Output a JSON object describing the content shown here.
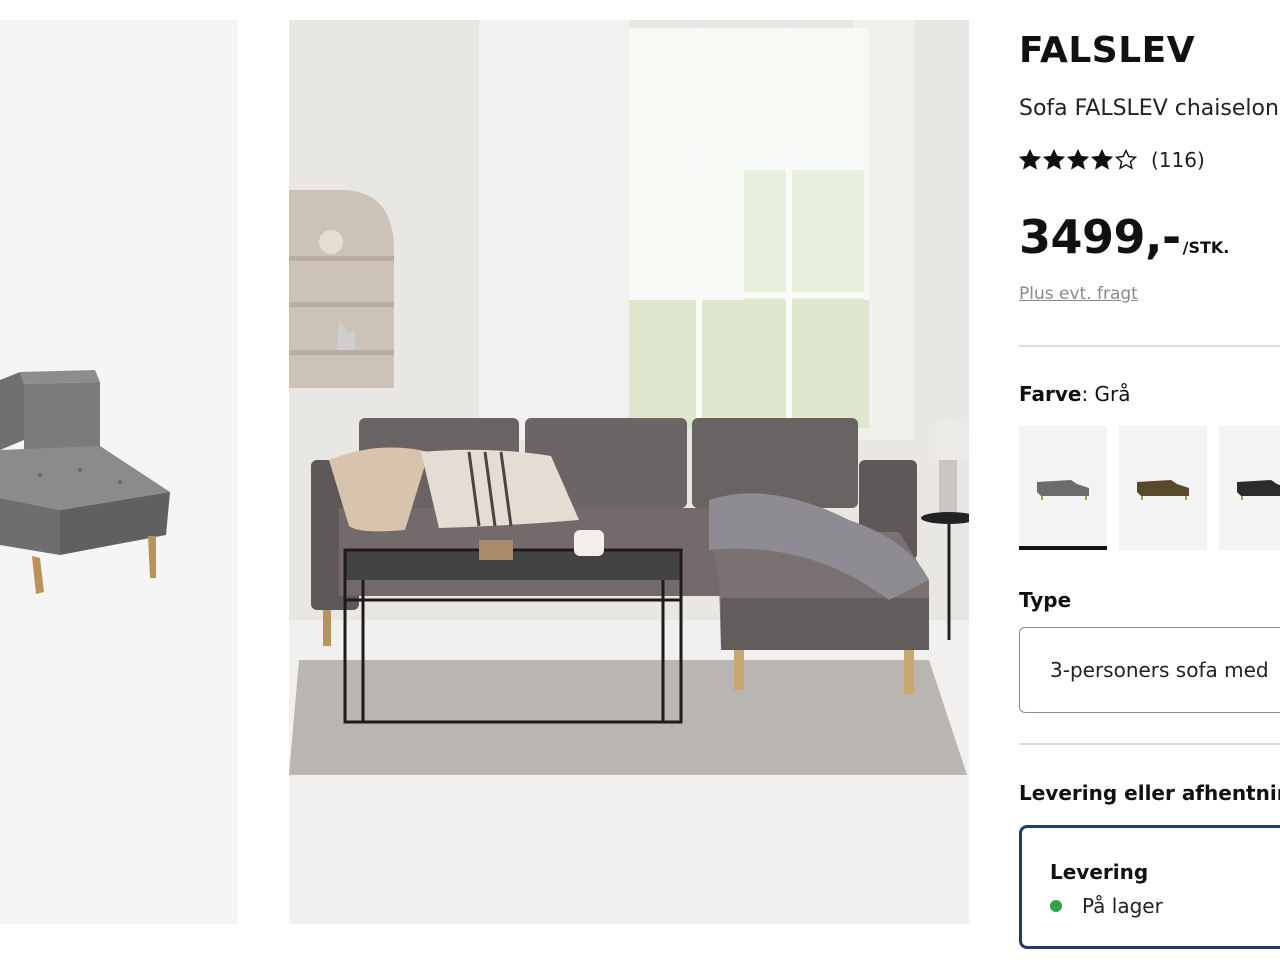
{
  "product": {
    "brand": "FALSLEV",
    "subtitle": "Sofa FALSLEV chaiselon",
    "rating_stars": 4,
    "rating_max": 5,
    "rating_count": "(116)",
    "price": "3499,-",
    "price_unit": "/STK.",
    "freight_link": "Plus evt. fragt"
  },
  "color": {
    "label": "Farve",
    "separator": ":",
    "value": " Grå",
    "swatches": [
      {
        "name": "grey-sofa",
        "color": "#6b6c6e",
        "selected": true
      },
      {
        "name": "brown-sofa",
        "color": "#5a4a2c",
        "selected": false
      },
      {
        "name": "black-sofa",
        "color": "#2b2c2e",
        "selected": false
      }
    ]
  },
  "type": {
    "label": "Type",
    "selected_value": "3-personers sofa med"
  },
  "delivery": {
    "label": "Levering eller afhentnin",
    "option_title": "Levering",
    "stock_status": "På lager",
    "stock_color": "#2ea34a",
    "selected_border_color": "#1f3d66"
  }
}
